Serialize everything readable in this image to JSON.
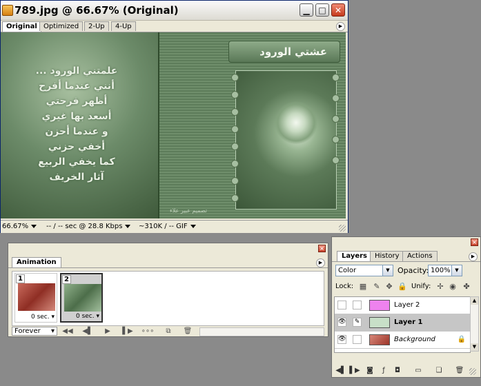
{
  "doc_window": {
    "title": "789.jpg @ 66.67% (Original)",
    "tabs": [
      "Original",
      "Optimized",
      "2-Up",
      "4-Up"
    ],
    "artwork": {
      "title_arabic": "عشتي الورود",
      "poem_lines": [
        "علمتني الورود ...",
        "أنني عندما أفرح",
        "أظهر فرحتي",
        "أسعد بها غيري",
        "و عندما أحزن",
        "أخفي حزني",
        "كما يخفي الربيع",
        "آثار الخريف"
      ],
      "signature_right": "تصميم عبير علاء"
    },
    "status": {
      "zoom": "66.67%",
      "download_time": "-- / -- sec @ 28.8 Kbps",
      "file_size": "~310K / -- GIF"
    }
  },
  "animation_palette": {
    "tab": "Animation",
    "frames": [
      {
        "number": "1",
        "delay": "0 sec."
      },
      {
        "number": "2",
        "delay": "0 sec."
      }
    ],
    "loop": "Forever"
  },
  "layers_palette": {
    "tabs": [
      "Layers",
      "History",
      "Actions"
    ],
    "blend_mode": "Color",
    "opacity_label": "Opacity:",
    "opacity": "100%",
    "lock_label": "Lock:",
    "unify_label": "Unify:",
    "layers": [
      {
        "name": "Layer 2",
        "visible": false,
        "thumb_color": "#ee82ee"
      },
      {
        "name": "Layer 1",
        "visible": true,
        "selected": true,
        "thumb_color": "#c8e0c8"
      },
      {
        "name": "Background",
        "visible": true,
        "locked": true,
        "thumb_color": "#b84a3c"
      }
    ]
  }
}
